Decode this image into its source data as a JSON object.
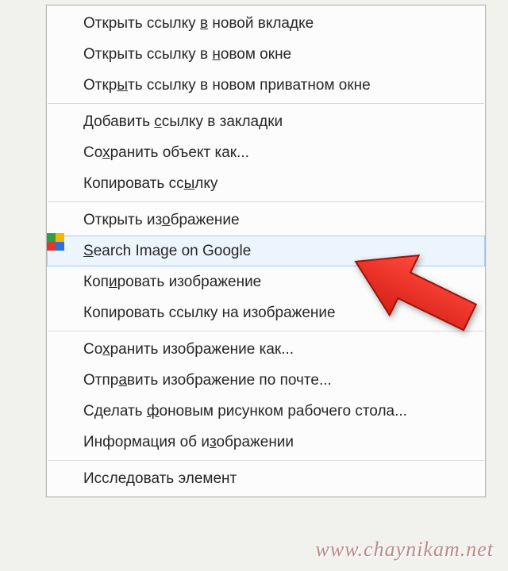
{
  "arrow_color": "#ec2a1f",
  "watermark": "www.chaynikam.net",
  "menu": {
    "groups": [
      [
        {
          "pre": "Открыть ссылку ",
          "u": "в",
          "post": " новой вкладке",
          "icon": null,
          "highlight": false
        },
        {
          "pre": "Открыть ссылку в ",
          "u": "н",
          "post": "овом окне",
          "icon": null,
          "highlight": false
        },
        {
          "pre": "Откр",
          "u": "ы",
          "post": "ть ссылку в новом приватном окне",
          "icon": null,
          "highlight": false
        }
      ],
      [
        {
          "pre": "Добавить ",
          "u": "с",
          "post": "сылку в закладки",
          "icon": null,
          "highlight": false
        },
        {
          "pre": "Со",
          "u": "х",
          "post": "ранить объект как...",
          "icon": null,
          "highlight": false
        },
        {
          "pre": "Копировать сс",
          "u": "ы",
          "post": "лку",
          "icon": null,
          "highlight": false
        }
      ],
      [
        {
          "pre": "Открыть из",
          "u": "о",
          "post": "бражение",
          "icon": null,
          "highlight": false
        },
        {
          "pre": "",
          "u": "S",
          "post": "earch Image on Google",
          "icon": "google",
          "highlight": true
        },
        {
          "pre": "Коп",
          "u": "и",
          "post": "ровать изображение",
          "icon": null,
          "highlight": false
        },
        {
          "pre": "Копировать ссылку на изображение",
          "u": "",
          "post": "",
          "icon": null,
          "highlight": false
        }
      ],
      [
        {
          "pre": "Со",
          "u": "х",
          "post": "ранить изображение как...",
          "icon": null,
          "highlight": false
        },
        {
          "pre": "Отпр",
          "u": "а",
          "post": "вить изображение по почте...",
          "icon": null,
          "highlight": false
        },
        {
          "pre": "Сделать ",
          "u": "ф",
          "post": "оновым рисунком рабочего стола...",
          "icon": null,
          "highlight": false
        },
        {
          "pre": "Информация об и",
          "u": "з",
          "post": "ображении",
          "icon": null,
          "highlight": false
        }
      ],
      [
        {
          "pre": "Иссле",
          "u": "д",
          "post": "овать элемент",
          "icon": null,
          "highlight": false
        }
      ]
    ]
  }
}
